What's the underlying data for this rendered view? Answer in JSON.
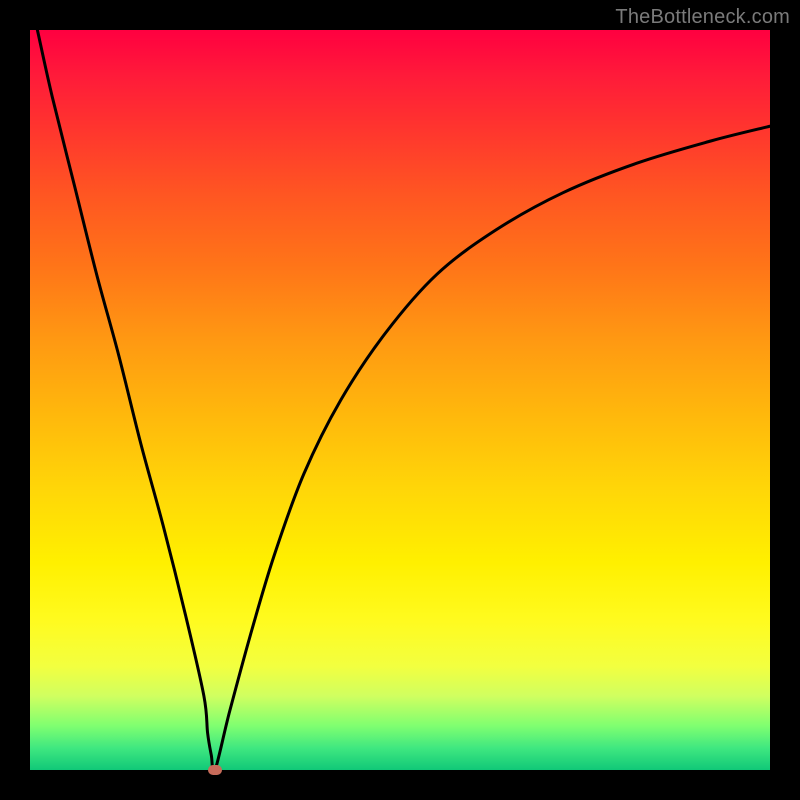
{
  "watermark": "TheBottleneck.com",
  "colors": {
    "gradient_top": "#ff0040",
    "gradient_bottom": "#10c878",
    "curve": "#000000",
    "marker": "#c76b5a",
    "frame": "#000000"
  },
  "chart_data": {
    "type": "line",
    "title": "",
    "xlabel": "",
    "ylabel": "",
    "xlim": [
      0,
      100
    ],
    "ylim": [
      0,
      100
    ],
    "grid": false,
    "legend": false,
    "annotations": [],
    "series": [
      {
        "name": "curve",
        "x": [
          1,
          3,
          6,
          9,
          12,
          15,
          18,
          21,
          23.5,
          24,
          24.5,
          25,
          27,
          30,
          33,
          37,
          42,
          48,
          55,
          63,
          72,
          82,
          92,
          100
        ],
        "y": [
          100,
          91,
          79,
          67,
          56,
          44,
          33,
          21,
          10,
          5,
          2,
          0,
          8,
          19,
          29,
          40,
          50,
          59,
          67,
          73,
          78,
          82,
          85,
          87
        ]
      }
    ],
    "minimum_marker": {
      "x": 25,
      "y": 0
    }
  }
}
